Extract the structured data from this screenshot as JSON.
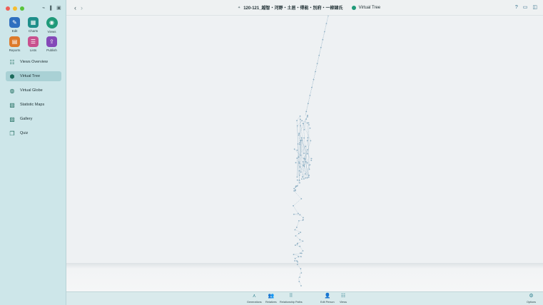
{
  "window": {
    "title": "120-121_越智・河野・土居・得能・別府・一柳諸氏",
    "view_name": "Virtual Tree"
  },
  "modules": [
    {
      "label": "Edit",
      "icon": "pencil-icon",
      "glyph": "✎"
    },
    {
      "label": "Charts",
      "icon": "charts-icon",
      "glyph": "▦"
    },
    {
      "label": "Views",
      "icon": "eye-icon",
      "glyph": "◉"
    },
    {
      "label": "Reports",
      "icon": "reports-icon",
      "glyph": "▤"
    },
    {
      "label": "Lists",
      "icon": "lists-icon",
      "glyph": "☰"
    },
    {
      "label": "Publish",
      "icon": "publish-icon",
      "glyph": "⇪"
    }
  ],
  "sidebar": {
    "items": [
      {
        "label": "Views Overview",
        "icon": "views-overview-icon",
        "glyph": "☷",
        "active": false
      },
      {
        "label": "Virtual Tree",
        "icon": "virtual-tree-icon",
        "glyph": "⬢",
        "active": true
      },
      {
        "label": "Virtual Globe",
        "icon": "virtual-globe-icon",
        "glyph": "◍",
        "active": false
      },
      {
        "label": "Statistic Maps",
        "icon": "statistic-maps-icon",
        "glyph": "▧",
        "active": false
      },
      {
        "label": "Gallery",
        "icon": "gallery-icon",
        "glyph": "▨",
        "active": false
      },
      {
        "label": "Quiz",
        "icon": "quiz-icon",
        "glyph": "❐",
        "active": false
      }
    ]
  },
  "toolbar_icons": {
    "help": "?",
    "folder": "▭",
    "sidebar_toggle": "◫"
  },
  "bottom_tools": [
    {
      "label": "Generations",
      "icon": "generations-icon",
      "glyph": "⋏"
    },
    {
      "label": "Relatives",
      "icon": "relatives-icon",
      "glyph": "👥"
    },
    {
      "label": "Relationship Paths",
      "icon": "relationship-paths-icon",
      "glyph": "⠿"
    },
    {
      "label": "Edit Person",
      "icon": "edit-person-icon",
      "glyph": "👤"
    },
    {
      "label": "Views",
      "icon": "views-list-icon",
      "glyph": "☷"
    },
    {
      "label": "Options",
      "icon": "options-icon",
      "glyph": "⚙"
    }
  ],
  "colors": {
    "accent": "#1f9a79",
    "sidebar_bg": "#cde6e9",
    "tree_node": "#8fb0c4"
  }
}
